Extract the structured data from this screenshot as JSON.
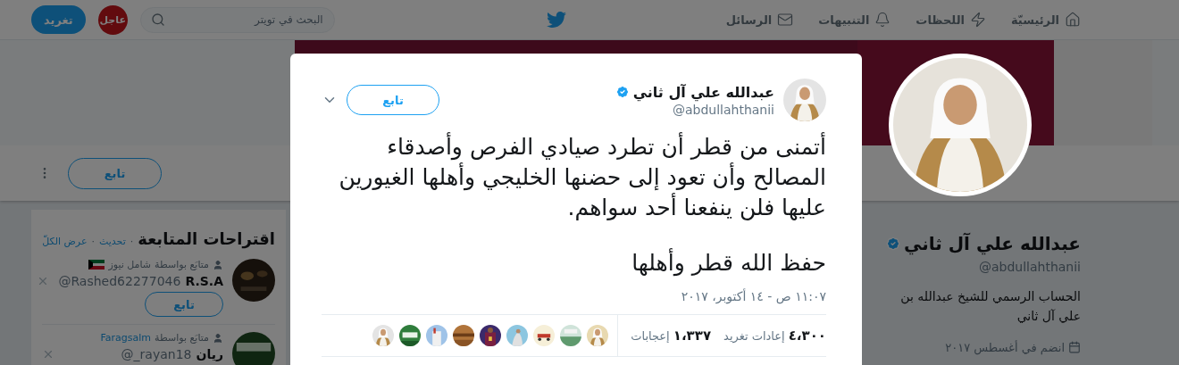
{
  "header": {
    "nav": [
      {
        "label": "الرئيسيّة",
        "selected": false
      },
      {
        "label": "اللحظات",
        "selected": false
      },
      {
        "label": "التنبيهات",
        "selected": false
      },
      {
        "label": "الرسائل",
        "selected": false
      }
    ],
    "search": {
      "placeholder": "البحث في تويتر"
    },
    "breaking_badge": "عاجل",
    "tweet_button": "تغريد"
  },
  "profile_nav": {
    "follow_button": "تابع"
  },
  "profile": {
    "name": "عبدالله علي آل ثاني",
    "verified": true,
    "handle": "@abdullahthanii",
    "bio": "الحساب الرسمي للشيخ عبدالله بن علي آل ثاني",
    "joined": "انضم في أغسطس ٢٠١٧"
  },
  "suggestions": {
    "title": "اقتراحات المتابعة",
    "separator": "·",
    "links": [
      "تحديث",
      "عرض الكلّ"
    ],
    "items": [
      {
        "followed_by_label": "متابَع بواسطة",
        "followed_by": "شامل نيوز",
        "followed_by_linked": false,
        "flag": true,
        "name": "R.S.A",
        "handle": "@Rashed62277046",
        "follow_button": "تابع"
      },
      {
        "followed_by_label": "متابَع بواسطة",
        "followed_by": "Faragsalm",
        "followed_by_linked": true,
        "flag": false,
        "name": "ريان",
        "handle": "@_rayan18"
      }
    ]
  },
  "tweet_modal": {
    "author": {
      "name": "عبدالله علي آل ثاني",
      "verified": true,
      "handle": "@abdullahthanii"
    },
    "follow_button": "تابع",
    "paragraphs": [
      "أتمنى من قطر أن تطرد صيادي الفرص وأصدقاء المصالح وأن تعود إلى حضنها الخليجي وأهلها الغيورين عليها فلن ينفعنا أحد سواهم.",
      "حفظ الله قطر وأهلها"
    ],
    "time": "١١:٠٧ ص - ١٤ أكتوبر، ٢٠١٧",
    "stats": [
      {
        "count": "٤،٣٠٠",
        "label": "إعادات تغريد"
      },
      {
        "count": "١،٣٣٧",
        "label": "إعجابات"
      }
    ]
  }
}
